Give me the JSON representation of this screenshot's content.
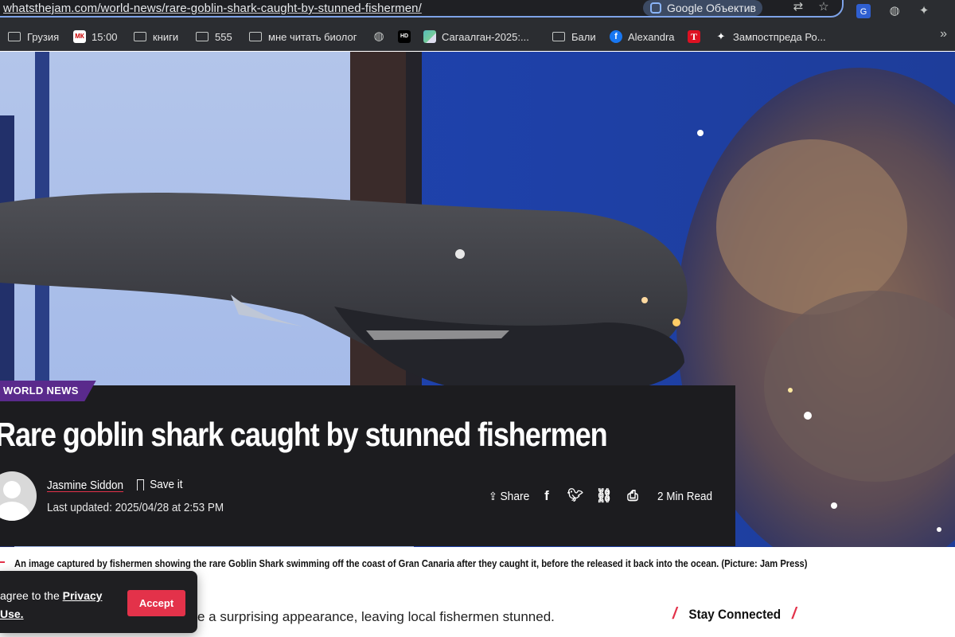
{
  "browser": {
    "url": "whatsthejam.com/world-news/rare-goblin-shark-caught-by-stunned-fishermen/",
    "lens_label": "Google Объектив",
    "bookmarks": [
      {
        "label": "Грузия",
        "icon": "folder-icon"
      },
      {
        "label": "15:00",
        "icon": "mk-favicon"
      },
      {
        "label": "книги",
        "icon": "folder-icon"
      },
      {
        "label": "555",
        "icon": "folder-icon"
      },
      {
        "label": "мне читать биолог",
        "icon": "folder-icon"
      },
      {
        "label": "",
        "icon": "globe-icon"
      },
      {
        "label": "",
        "icon": "hd-favicon"
      },
      {
        "label": "Сагаалган-2025:...",
        "icon": "map-favicon"
      },
      {
        "label": "Бали",
        "icon": "folder-icon"
      },
      {
        "label": "Alexandra",
        "icon": "facebook-favicon"
      },
      {
        "label": "",
        "icon": "t-favicon"
      },
      {
        "label": "Зампостпреда Ро...",
        "icon": "sparkle-favicon"
      }
    ]
  },
  "article": {
    "category": "WORLD NEWS",
    "title": "Rare goblin shark caught by stunned fishermen",
    "author": "Jasmine Siddon",
    "save_label": "Save it",
    "updated": "Last updated: 2025/04/28 at 2:53 PM",
    "share_label": "Share",
    "read_time": "2 Min Read",
    "caption": "An image captured by fishermen showing the rare Goblin Shark swimming off the coast of Gran Canaria after they caught it, before the released it back into the ocean. (Picture: Jam Press)",
    "body_visible": "e a surprising appearance, leaving local fishermen stunned."
  },
  "sidebar": {
    "stay_connected": "Stay Connected"
  },
  "cookie": {
    "text_prefix": "agree to the ",
    "link_text": "Privacy",
    "text_line2": "Use.",
    "accept_label": "Accept"
  },
  "colors": {
    "accent": "#e3324a",
    "badge": "#5a2a8c",
    "card": "#1c1c1f"
  }
}
